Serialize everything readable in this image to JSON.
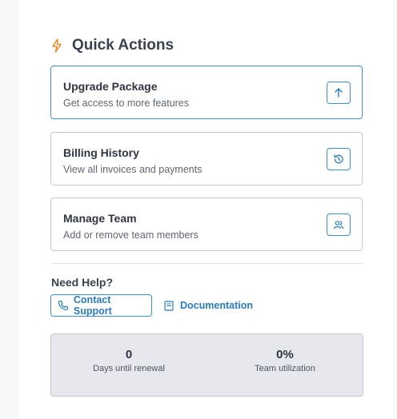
{
  "quick_actions": {
    "title": "Quick Actions",
    "icon": "lightning-icon",
    "accent_color": "#e88a2a",
    "items": [
      {
        "title": "Upgrade Package",
        "subtitle": "Get access to more features",
        "icon": "arrow-up-icon",
        "active": true
      },
      {
        "title": "Billing History",
        "subtitle": "View all invoices and payments",
        "icon": "history-icon",
        "active": false
      },
      {
        "title": "Manage Team",
        "subtitle": "Add or remove team members",
        "icon": "users-icon",
        "active": false
      }
    ]
  },
  "help": {
    "title": "Need Help?",
    "contact_label": "Contact Support",
    "contact_icon": "phone-icon",
    "docs_label": "Documentation",
    "docs_icon": "book-icon",
    "link_color": "#2a7cc2"
  },
  "stats": [
    {
      "value": "0",
      "label": "Days until renewal"
    },
    {
      "value": "0%",
      "label": "Team utilization"
    }
  ]
}
